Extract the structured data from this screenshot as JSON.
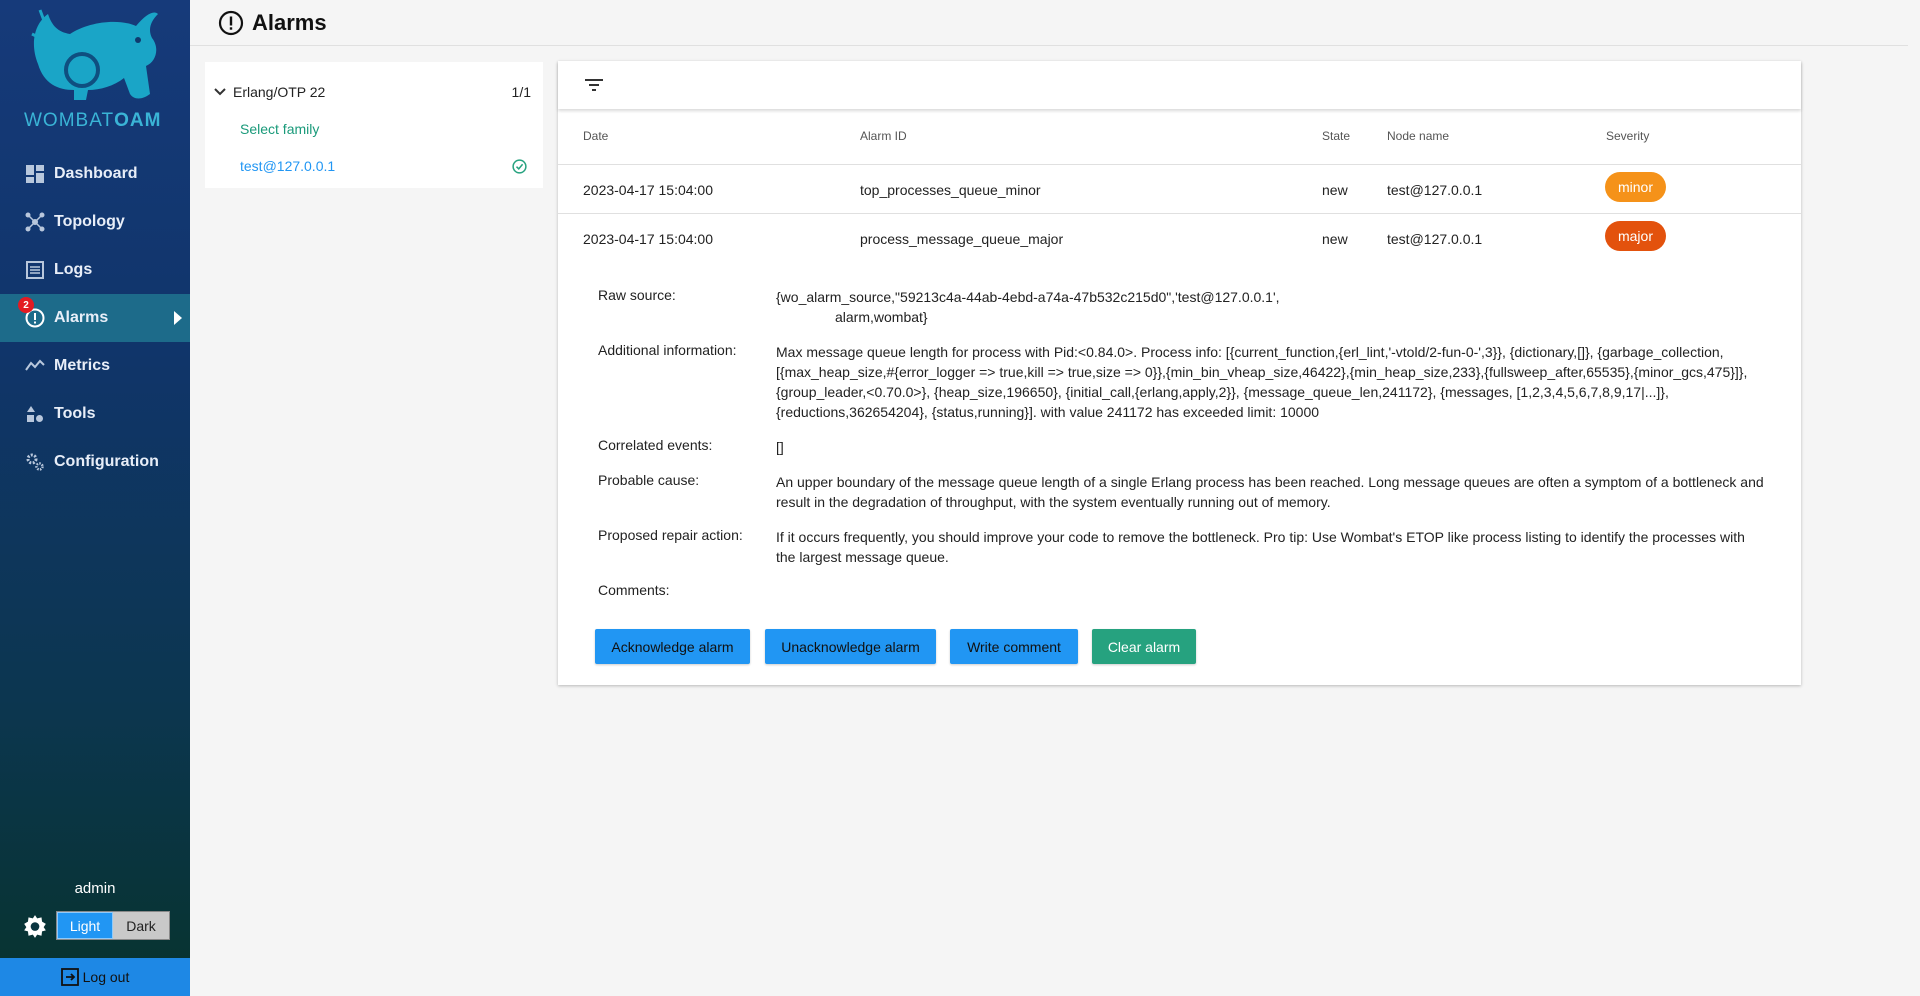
{
  "sidebar": {
    "logo_text_light": "WOMBAT",
    "logo_text_bold": "OAM",
    "items": [
      {
        "label": "Dashboard",
        "icon": "dashboard-icon"
      },
      {
        "label": "Topology",
        "icon": "topology-icon"
      },
      {
        "label": "Logs",
        "icon": "logs-icon"
      },
      {
        "label": "Alarms",
        "icon": "alarm-icon",
        "badge": "2",
        "active": true
      },
      {
        "label": "Metrics",
        "icon": "metrics-icon"
      },
      {
        "label": "Tools",
        "icon": "tools-icon"
      },
      {
        "label": "Configuration",
        "icon": "configuration-icon"
      }
    ],
    "user": "admin",
    "theme": {
      "light": "Light",
      "dark": "Dark",
      "selected": "Light"
    },
    "logout": "Log out"
  },
  "header": {
    "title": "Alarms"
  },
  "tree": {
    "family": "Erlang/OTP 22",
    "count": "1/1",
    "select_family": "Select family",
    "node": "test@127.0.0.1"
  },
  "table": {
    "columns": [
      "Date",
      "Alarm ID",
      "State",
      "Node name",
      "Severity"
    ],
    "rows": [
      {
        "date": "2023-04-17 15:04:00",
        "alarm_id": "top_processes_queue_minor",
        "state": "new",
        "node": "test@127.0.0.1",
        "severity": "minor"
      },
      {
        "date": "2023-04-17 15:04:00",
        "alarm_id": "process_message_queue_major",
        "state": "new",
        "node": "test@127.0.0.1",
        "severity": "major"
      }
    ]
  },
  "details": {
    "raw_source_label": "Raw source:",
    "raw_source_line1": "{wo_alarm_source,\"59213c4a-44ab-4ebd-a74a-47b532c215d0\",'test@127.0.0.1',",
    "raw_source_line2": "alarm,wombat}",
    "additional_label": "Additional information:",
    "additional_value": "Max message queue length for  process with Pid:<0.84.0>. Process info: [{current_function,{erl_lint,'-vtold/2-fun-0-',3}}, {dictionary,[]}, {garbage_collection, [{max_heap_size,#{error_logger => true,kill => true,size => 0}},{min_bin_vheap_size,46422},{min_heap_size,233},{fullsweep_after,65535},{minor_gcs,475}]}, {group_leader,<0.70.0>}, {heap_size,196650}, {initial_call,{erlang,apply,2}}, {message_queue_len,241172}, {messages, [1,2,3,4,5,6,7,8,9,17|...]}, {reductions,362654204}, {status,running}]. with value 241172 has exceeded limit: 10000",
    "correlated_label": "Correlated events:",
    "correlated_value": "[]",
    "cause_label": "Probable cause:",
    "cause_value": "An upper boundary of the message queue length of a single Erlang process has been reached. Long message queues are often a symptom of a bottleneck and result in the degradation of throughput, with the system eventually running out of memory.",
    "repair_label": "Proposed repair action:",
    "repair_value": "If it occurs frequently, you should improve your code to remove the bottleneck. Pro tip: Use Wombat's ETOP like process listing to identify the processes with the largest message queue.",
    "comments_label": "Comments:"
  },
  "actions": {
    "acknowledge": "Acknowledge alarm",
    "unacknowledge": "Unacknowledge alarm",
    "comment": "Write comment",
    "clear": "Clear alarm"
  },
  "colors": {
    "minor": "#f59219",
    "major": "#e3520d",
    "accent": "#2196f3",
    "success": "#26a27f"
  }
}
